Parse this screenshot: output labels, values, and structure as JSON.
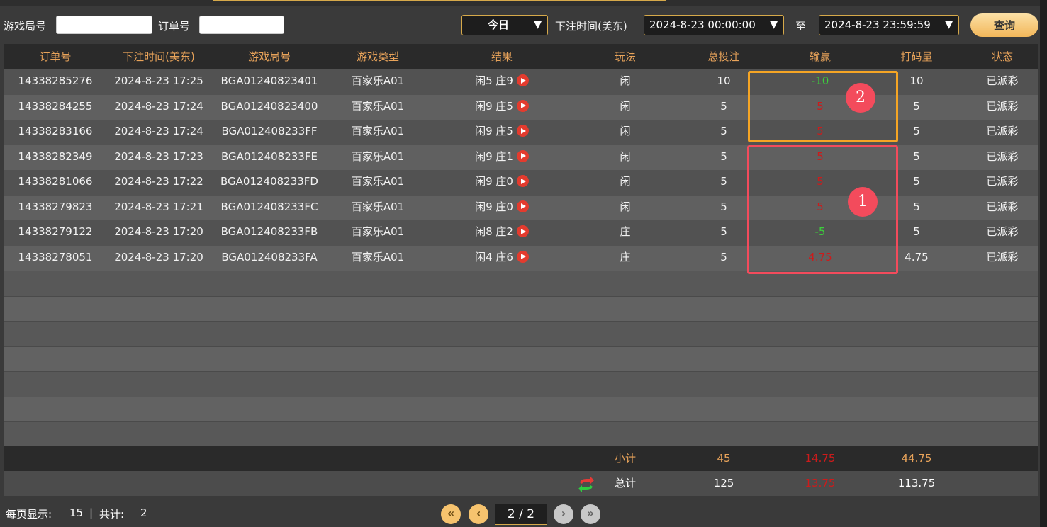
{
  "filters": {
    "game_round_label": "游戏局号",
    "game_round_value": "",
    "order_no_label": "订单号",
    "order_no_value": "",
    "period_value": "今日",
    "bet_time_label": "下注时间(美东)",
    "start_time": "2024-8-23 00:00:00",
    "to_label": "至",
    "end_time": "2024-8-23 23:59:59",
    "query_label": "查询"
  },
  "table": {
    "columns": [
      "订单号",
      "下注时间(美东)",
      "游戏局号",
      "游戏类型",
      "结果",
      "玩法",
      "总投注",
      "输赢",
      "打码量",
      "状态"
    ],
    "rows": [
      {
        "order": "14338285276",
        "time": "2024-8-23 17:25",
        "round": "BGA01240823401",
        "type": "百家乐A01",
        "result": "闲5 庄9",
        "play": "闲",
        "bet": "10",
        "winloss": "-10",
        "sign": "neg",
        "turnover": "10",
        "status": "已派彩"
      },
      {
        "order": "14338284255",
        "time": "2024-8-23 17:24",
        "round": "BGA01240823400",
        "type": "百家乐A01",
        "result": "闲9 庄5",
        "play": "闲",
        "bet": "5",
        "winloss": "5",
        "sign": "pos",
        "turnover": "5",
        "status": "已派彩"
      },
      {
        "order": "14338283166",
        "time": "2024-8-23 17:24",
        "round": "BGA012408233FF",
        "type": "百家乐A01",
        "result": "闲9 庄5",
        "play": "闲",
        "bet": "5",
        "winloss": "5",
        "sign": "pos",
        "turnover": "5",
        "status": "已派彩"
      },
      {
        "order": "14338282349",
        "time": "2024-8-23 17:23",
        "round": "BGA012408233FE",
        "type": "百家乐A01",
        "result": "闲9 庄1",
        "play": "闲",
        "bet": "5",
        "winloss": "5",
        "sign": "pos",
        "turnover": "5",
        "status": "已派彩"
      },
      {
        "order": "14338281066",
        "time": "2024-8-23 17:22",
        "round": "BGA012408233FD",
        "type": "百家乐A01",
        "result": "闲9 庄0",
        "play": "闲",
        "bet": "5",
        "winloss": "5",
        "sign": "pos",
        "turnover": "5",
        "status": "已派彩"
      },
      {
        "order": "14338279823",
        "time": "2024-8-23 17:21",
        "round": "BGA012408233FC",
        "type": "百家乐A01",
        "result": "闲9 庄0",
        "play": "闲",
        "bet": "5",
        "winloss": "5",
        "sign": "pos",
        "turnover": "5",
        "status": "已派彩"
      },
      {
        "order": "14338279122",
        "time": "2024-8-23 17:20",
        "round": "BGA012408233FB",
        "type": "百家乐A01",
        "result": "闲8 庄2",
        "play": "庄",
        "bet": "5",
        "winloss": "-5",
        "sign": "neg",
        "turnover": "5",
        "status": "已派彩"
      },
      {
        "order": "14338278051",
        "time": "2024-8-23 17:20",
        "round": "BGA012408233FA",
        "type": "百家乐A01",
        "result": "闲4 庄6",
        "play": "庄",
        "bet": "5",
        "winloss": "4.75",
        "sign": "pos",
        "turnover": "4.75",
        "status": "已派彩"
      }
    ]
  },
  "summary": {
    "subtotal_label": "小计",
    "subtotal_bet": "45",
    "subtotal_winloss": "14.75",
    "subtotal_turnover": "44.75",
    "total_label": "总计",
    "total_bet": "125",
    "total_winloss": "13.75",
    "total_turnover": "113.75"
  },
  "annotations": [
    {
      "label": "2",
      "color": "#f5a524"
    },
    {
      "label": "1",
      "color": "#f34b5c"
    }
  ],
  "pager": {
    "per_page_label": "每页显示:",
    "per_page_value": "15",
    "separator": "|",
    "total_label": "共计:",
    "total_value": "2",
    "page_display": "2 / 2",
    "first_icon": "«",
    "prev_icon": "‹",
    "next_icon": "›",
    "last_icon": "»"
  },
  "colors": {
    "accent_gold": "#d6a94a",
    "header_text": "#e8a35a",
    "loss_red": "#cc1b1b",
    "win_green": "#3bd13b"
  }
}
